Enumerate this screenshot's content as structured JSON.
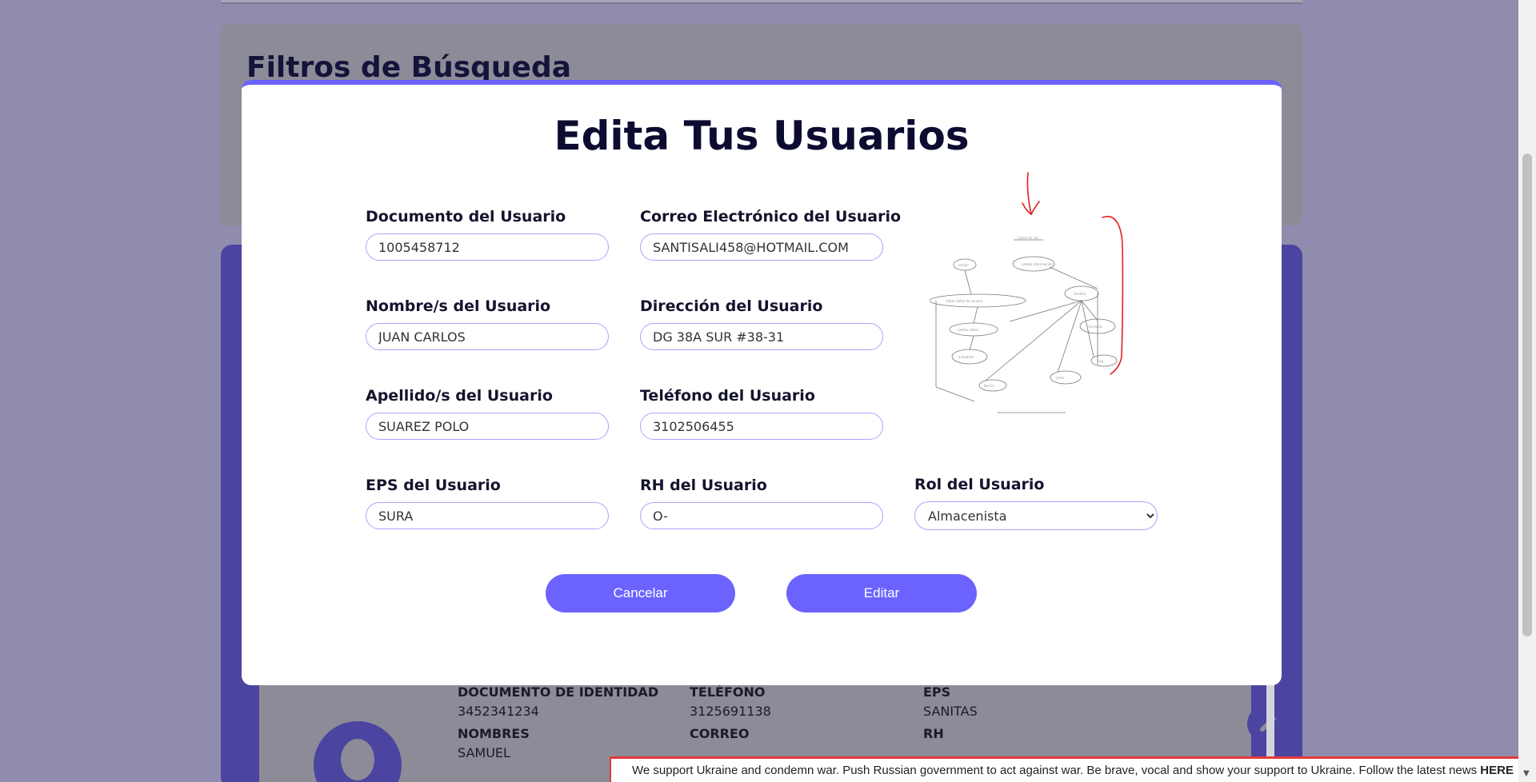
{
  "background": {
    "filters_title": "Filtros de Búsqueda",
    "user_card": {
      "labels": {
        "document": "DOCUMENTO DE IDENTIDAD",
        "phone": "TELÉFONO",
        "eps": "EPS",
        "names": "NOMBRES",
        "email": "CORREO",
        "rh": "RH"
      },
      "values": {
        "document": "3452341234",
        "phone": "3125691138",
        "eps": "SANITAS",
        "names": "SAMUEL"
      }
    }
  },
  "modal": {
    "title": "Edita Tus Usuarios",
    "fields": {
      "document": {
        "label": "Documento del Usuario",
        "value": "1005458712"
      },
      "email": {
        "label": "Correo Electrónico del Usuario",
        "value": "SANTISALI458@HOTMAIL.COM"
      },
      "names": {
        "label": "Nombre/s del Usuario",
        "value": "JUAN CARLOS"
      },
      "address": {
        "label": "Dirección del Usuario",
        "value": "DG 38A SUR #38-31"
      },
      "surnames": {
        "label": "Apellido/s del Usuario",
        "value": "SUAREZ POLO"
      },
      "phone": {
        "label": "Teléfono del Usuario",
        "value": "3102506455"
      },
      "eps": {
        "label": "EPS del Usuario",
        "value": "SURA"
      },
      "rh": {
        "label": "RH del Usuario",
        "value": "O-"
      },
      "role": {
        "label": "Rol del Usuario",
        "value": "Almacenista"
      }
    },
    "buttons": {
      "cancel": "Cancelar",
      "edit": "Editar"
    }
  },
  "banner": {
    "text": "We support Ukraine and condemn war. Push Russian government to act against war. Be brave, vocal and show your support to Ukraine. Follow the latest news ",
    "link": "HERE"
  },
  "colors": {
    "accent": "#6c63ff",
    "panel": "#4b44a0",
    "title": "#0c0b30",
    "annotation": "#e02020"
  },
  "icons": {
    "edit": "pencil-icon",
    "select": "chevron-down-icon"
  }
}
